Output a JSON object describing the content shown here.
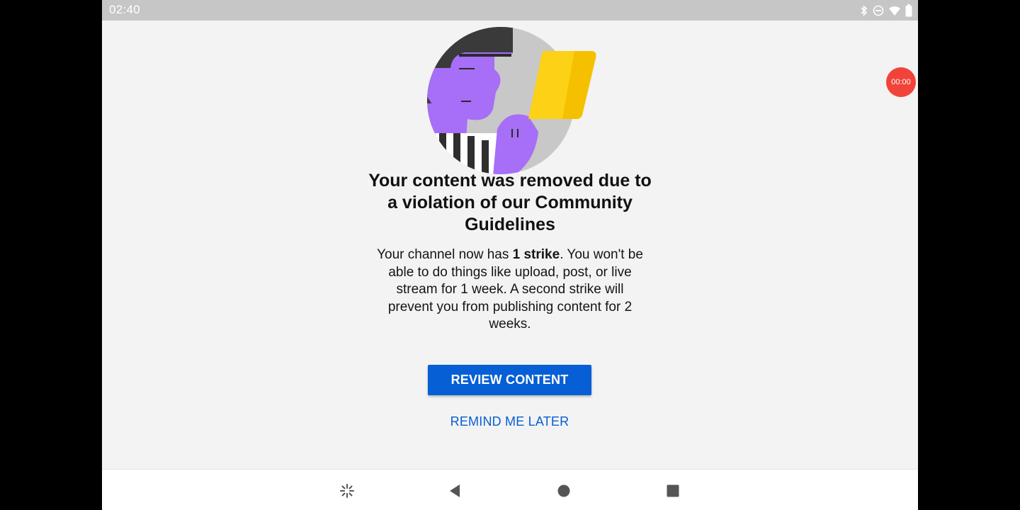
{
  "status_bar": {
    "time": "02:40",
    "icons": [
      "bluetooth-icon",
      "do-not-disturb-icon",
      "wifi-icon",
      "battery-icon"
    ]
  },
  "recording_badge": {
    "time": "00:00",
    "color": "#f2433a"
  },
  "dialog": {
    "title": "Your content was removed due to a violation of our Community Guidelines",
    "body_prefix": "Your channel now has ",
    "body_bold": "1 strike",
    "body_suffix": ". You won't be able to do things like upload, post, or live stream for 1 week. A second strike will prevent you from publishing content for 2 weeks.",
    "primary_button": "REVIEW CONTENT",
    "secondary_button": "REMIND ME LATER"
  },
  "nav_bar": {
    "buttons": [
      "assistant-icon",
      "back-icon",
      "home-icon",
      "recents-icon"
    ]
  },
  "colors": {
    "accent": "#065fd4",
    "background": "#f3f3f3",
    "status_bar": "#c6c6c6",
    "illustration_purple": "#b378fa",
    "illustration_yellow": "#fcd116"
  }
}
